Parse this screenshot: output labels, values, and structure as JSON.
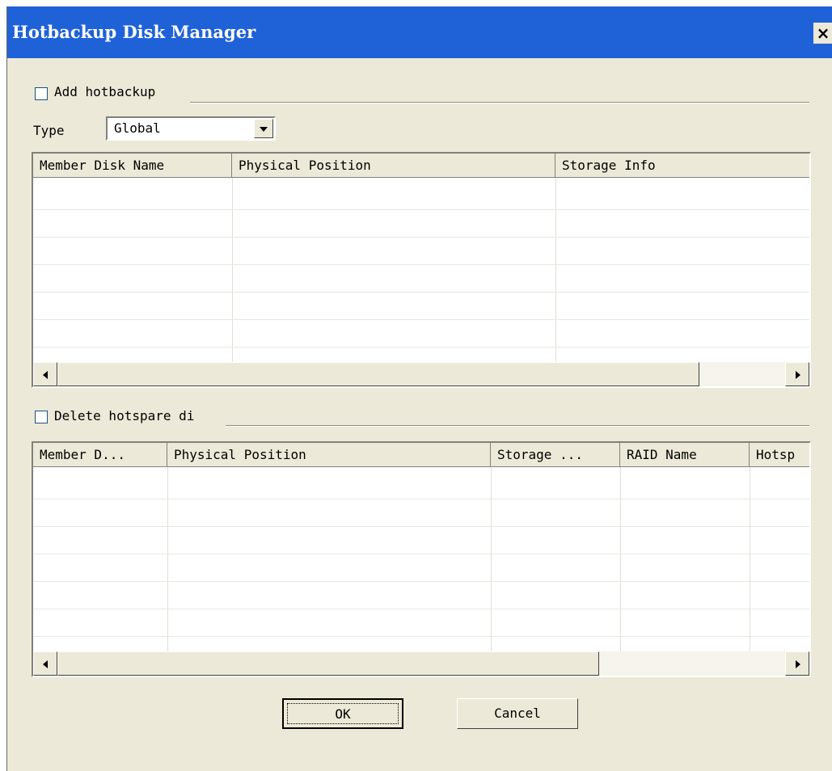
{
  "window": {
    "title": "Hotbackup Disk Manager",
    "close_label": "×"
  },
  "add_section": {
    "checkbox_label": "Add hotbackup",
    "checked": false,
    "type_label": "Type",
    "type_value": "Global",
    "columns": [
      "Member Disk Name",
      "Physical Position",
      "Storage Info"
    ]
  },
  "delete_section": {
    "checkbox_label": "Delete hotspare di",
    "checked": false,
    "columns": [
      "Member D...",
      "Physical Position",
      "Storage ...",
      "RAID Name",
      "Hotsp"
    ]
  },
  "buttons": {
    "ok": "OK",
    "cancel": "Cancel"
  }
}
